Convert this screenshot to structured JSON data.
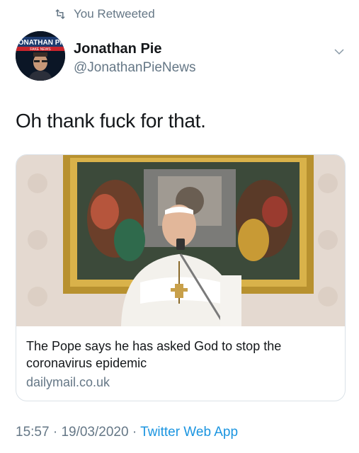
{
  "retweet": {
    "label": "You Retweeted",
    "icon": "retweet-icon"
  },
  "author": {
    "name": "Jonathan Pie",
    "handle": "@JonathanPieNews",
    "avatar_banner_text": "JONATHAN PIE",
    "avatar_banner_subtext": "FAKE NEWS"
  },
  "tweet": {
    "text": "Oh thank fuck for that."
  },
  "card": {
    "title": "The Pope says he has asked God to stop the coronavirus epidemic",
    "domain": "dailymail.co.uk"
  },
  "meta": {
    "time": "15:57",
    "separator": "·",
    "date": "19/03/2020",
    "app": "Twitter Web App"
  },
  "colors": {
    "secondary": "#657786",
    "link": "#1b95e0",
    "text": "#14171a"
  }
}
